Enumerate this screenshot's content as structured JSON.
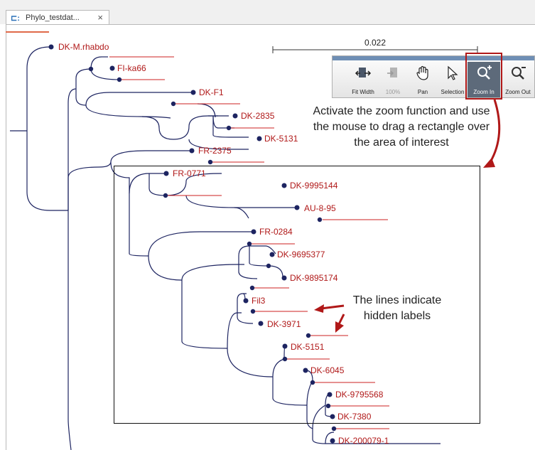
{
  "tab": {
    "icon": "tree-icon",
    "title": "Phylo_testdat...",
    "close": "×"
  },
  "scale_bar": {
    "label": "0.022"
  },
  "toolbar": {
    "buttons": [
      {
        "name": "fit-width",
        "label": "Fit Width",
        "icon": "fit-width-icon",
        "enabled": true
      },
      {
        "name": "100-percent",
        "label": "100%",
        "icon": "100-percent-icon",
        "enabled": false
      },
      {
        "name": "pan",
        "label": "Pan",
        "icon": "hand-icon",
        "enabled": true
      },
      {
        "name": "selection",
        "label": "Selection",
        "icon": "arrow-cursor-icon",
        "enabled": true
      },
      {
        "name": "zoom-in",
        "label": "Zoom In",
        "icon": "zoom-in-icon",
        "enabled": true,
        "active": true
      },
      {
        "name": "zoom-out",
        "label": "Zoom Out",
        "icon": "zoom-out-icon",
        "enabled": true
      }
    ]
  },
  "callouts": {
    "zoom": [
      "Activate the zoom function and use",
      "the mouse to drag a rectangle over",
      "the area of interest"
    ],
    "lines": [
      "The lines indicate",
      "hidden labels"
    ]
  },
  "tree": {
    "labels": [
      "DK-M.rhabdo",
      "FI-ka66",
      "DK-F1",
      "DK-2835",
      "DK-5131",
      "FR-2375",
      "FR-0771",
      "DK-9995144",
      "AU-8-95",
      "FR-0284",
      "DK-9695377",
      "DK-9895174",
      "Fil3",
      "DK-3971",
      "DK-5151",
      "DK-6045",
      "DK-9795568",
      "DK-7380",
      "DK-200079-1"
    ]
  },
  "colors": {
    "branch": "#1d2461",
    "label": "#b01818",
    "hidden_line": "#cc2222",
    "annotation": "#b01818"
  }
}
